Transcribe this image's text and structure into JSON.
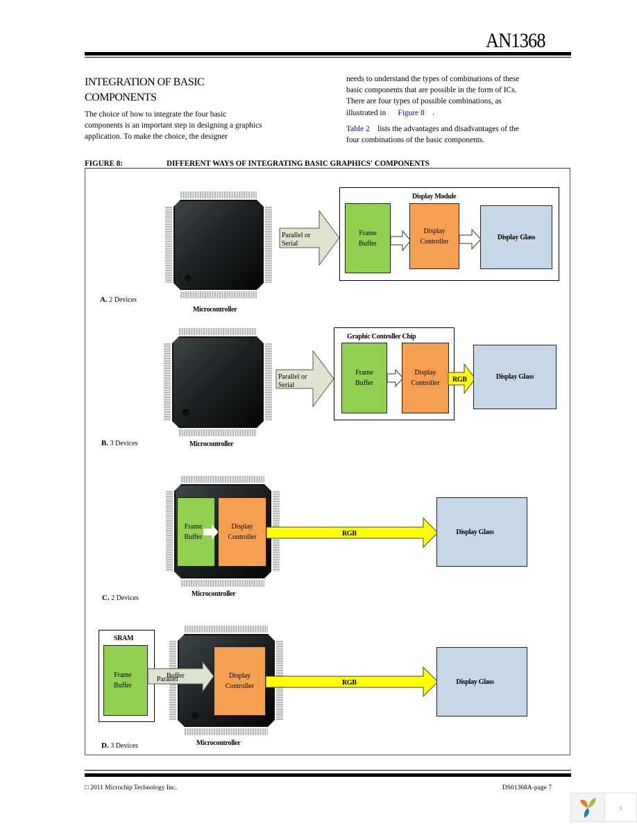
{
  "header": {
    "doc_id": "AN1368"
  },
  "section": {
    "title": "INTEGRATION OF BASIC COMPONENTS",
    "left_para": "The choice of how to integrate the four basic components is an important step in designing a graphics application. To make the choice, the designer",
    "right_para_1_pre": "needs to understand the types of combinations of these basic components that are possible in the form of ICs. There are four types of possible combinations, as illustrated in",
    "right_para_1_link": "Figure 8",
    "right_para_1_post": ".",
    "right_para_2_link": "Table 2",
    "right_para_2_post": "lists the advantages and disadvantages of the four combinations of the basic components."
  },
  "figure": {
    "label": "FIGURE 8:",
    "title": "DIFFERENT WAYS OF INTEGRATING BASIC GRAPHICS' COMPONENTS",
    "colors": {
      "frame_buffer": "#92d050",
      "display_controller": "#f79f51",
      "display_glass": "#c6d7e8",
      "rgb_arrow": "#ffff00",
      "bus_arrow": "#dde3cf"
    },
    "sections": [
      {
        "letter": "A.",
        "devices": "2 Devices",
        "chip_label": "Microcontroller",
        "bus_label": "Parallel or Serial",
        "module_title": "Display Module",
        "frame_buffer": "Frame Buffer",
        "display_controller": "Display Controller",
        "display_glass": "Display Glass"
      },
      {
        "letter": "B.",
        "devices": "3 Devices",
        "chip_label": "Microcontroller",
        "bus_label": "Parallel or Serial",
        "module_title": "Graphic Controller Chip",
        "frame_buffer": "Frame Buffer",
        "display_controller": "Display Controller",
        "rgb_label": "RGB",
        "display_glass": "Display Glass"
      },
      {
        "letter": "C.",
        "devices": "2 Devices",
        "chip_label": "Microcontroller",
        "frame_buffer": "Frame Buffer",
        "display_controller": "Display Controller",
        "rgb_label": "RGB",
        "display_glass": "Display Glass"
      },
      {
        "letter": "D.",
        "devices": "3 Devices",
        "chip_label": "Microcontroller",
        "sram_title": "SRAM",
        "frame_buffer": "Frame Buffer",
        "bus_label": "Parallel",
        "bus_overlap_label": "Buffer",
        "display_controller": "Display Controller",
        "rgb_label": "RGB",
        "display_glass": "Display Glass"
      }
    ]
  },
  "footer": {
    "copyright": "□ 2011 Microchip Technology Inc.",
    "page": "DS01368A-page 7"
  },
  "viewer": {
    "logo_icon": "yii-logo-icon",
    "next_icon": "chevron-right-icon",
    "next_glyph": "›"
  }
}
